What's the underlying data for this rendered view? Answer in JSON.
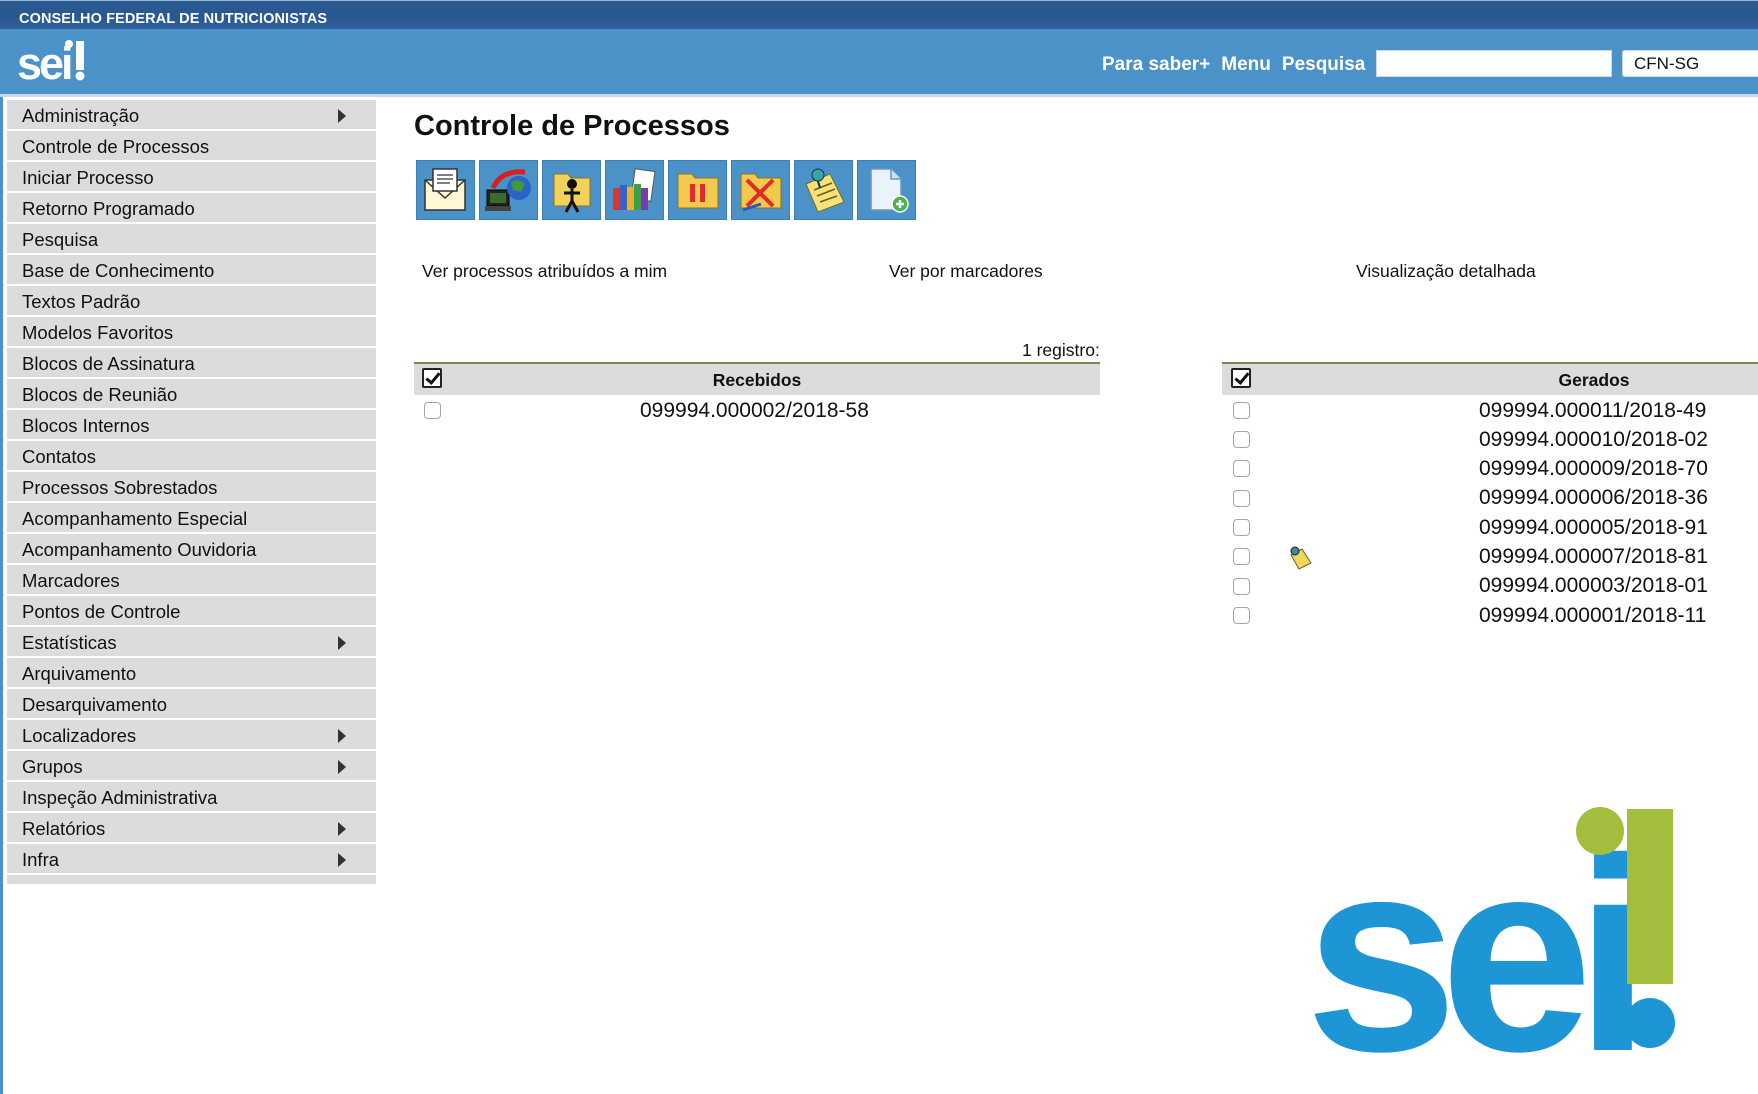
{
  "header": {
    "org_name": "CONSELHO FEDERAL DE NUTRICIONISTAS",
    "logo_text": "sei!",
    "links": [
      "Para saber+",
      "Menu",
      "Pesquisa"
    ],
    "search_value": "",
    "unit": "CFN-SG"
  },
  "sidebar": {
    "items": [
      {
        "label": "Administração",
        "submenu": true
      },
      {
        "label": "Controle de Processos",
        "submenu": false
      },
      {
        "label": "Iniciar Processo",
        "submenu": false
      },
      {
        "label": "Retorno Programado",
        "submenu": false
      },
      {
        "label": "Pesquisa",
        "submenu": false
      },
      {
        "label": "Base de Conhecimento",
        "submenu": false
      },
      {
        "label": "Textos Padrão",
        "submenu": false
      },
      {
        "label": "Modelos Favoritos",
        "submenu": false
      },
      {
        "label": "Blocos de Assinatura",
        "submenu": false
      },
      {
        "label": "Blocos de Reunião",
        "submenu": false
      },
      {
        "label": "Blocos Internos",
        "submenu": false
      },
      {
        "label": "Contatos",
        "submenu": false
      },
      {
        "label": "Processos Sobrestados",
        "submenu": false
      },
      {
        "label": "Acompanhamento Especial",
        "submenu": false
      },
      {
        "label": "Acompanhamento Ouvidoria",
        "submenu": false
      },
      {
        "label": "Marcadores",
        "submenu": false
      },
      {
        "label": "Pontos de Controle",
        "submenu": false
      },
      {
        "label": "Estatísticas",
        "submenu": true
      },
      {
        "label": "Arquivamento",
        "submenu": false
      },
      {
        "label": "Desarquivamento",
        "submenu": false
      },
      {
        "label": "Localizadores",
        "submenu": true
      },
      {
        "label": "Grupos",
        "submenu": true
      },
      {
        "label": "Inspeção Administrativa",
        "submenu": false
      },
      {
        "label": "Relatórios",
        "submenu": true
      },
      {
        "label": "Infra",
        "submenu": true
      }
    ]
  },
  "main": {
    "title": "Controle de Processos",
    "toolbar_icons": [
      "send-process-icon",
      "update-progress-icon",
      "assign-process-icon",
      "library-icon",
      "suspend-process-icon",
      "conclude-process-icon",
      "note-icon",
      "new-document-icon"
    ],
    "links": {
      "assigned": "Ver processos atribuídos a mim",
      "markers": "Ver por marcadores",
      "detailed": "Visualização detalhada"
    },
    "count_label": "1 registro:",
    "received": {
      "header": "Recebidos",
      "items": [
        "099994.000002/2018-58"
      ]
    },
    "generated": {
      "header": "Gerados",
      "items": [
        {
          "number": "099994.000011/2018-49",
          "note": false
        },
        {
          "number": "099994.000010/2018-02",
          "note": false
        },
        {
          "number": "099994.000009/2018-70",
          "note": false
        },
        {
          "number": "099994.000006/2018-36",
          "note": false
        },
        {
          "number": "099994.000005/2018-91",
          "note": false
        },
        {
          "number": "099994.000007/2018-81",
          "note": true
        },
        {
          "number": "099994.000003/2018-01",
          "note": false
        },
        {
          "number": "099994.000001/2018-11",
          "note": false
        }
      ]
    }
  },
  "colors": {
    "header_blue": "#4b92c9",
    "org_bar": "#2b5a93",
    "logo_blue": "#1e96d6",
    "logo_green": "#a3bd3c",
    "menu_bg": "#dcdcdc"
  }
}
